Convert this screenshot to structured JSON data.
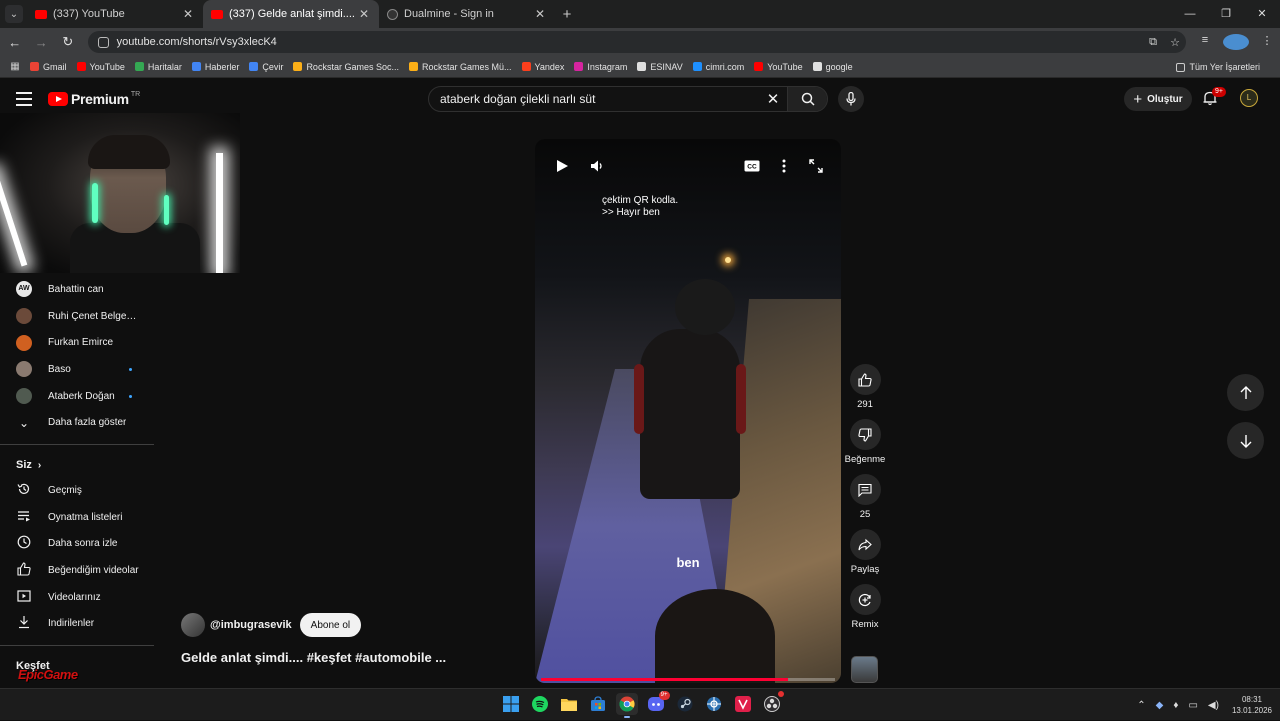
{
  "browser": {
    "tabs": [
      {
        "title": "(337) YouTube",
        "active": false
      },
      {
        "title": "(337) Gelde anlat şimdi.... #keşf",
        "active": true
      },
      {
        "title": "Dualmine - Sign in",
        "active": false
      }
    ],
    "url": "youtube.com/shorts/rVsy3xlecK4",
    "bookmarks": [
      {
        "label": "Gmail",
        "color": "#ea4335"
      },
      {
        "label": "YouTube",
        "color": "#ff0000"
      },
      {
        "label": "Haritalar",
        "color": "#34a853"
      },
      {
        "label": "Haberler",
        "color": "#4285f4"
      },
      {
        "label": "Çevir",
        "color": "#4285f4"
      },
      {
        "label": "Rockstar Games Soc...",
        "color": "#fcaf17"
      },
      {
        "label": "Rockstar Games Mü...",
        "color": "#fcaf17"
      },
      {
        "label": "Yandex",
        "color": "#fc3f1d"
      },
      {
        "label": "Instagram",
        "color": "#d6249f"
      },
      {
        "label": "ESINAV",
        "color": "#e0e0e0"
      },
      {
        "label": "cimri.com",
        "color": "#1e90ff"
      },
      {
        "label": "YouTube",
        "color": "#ff0000"
      },
      {
        "label": "google",
        "color": "#e0e0e0"
      }
    ],
    "all_bookmarks": "Tüm Yer İşaretleri"
  },
  "youtube": {
    "logo_text": "Premium",
    "logo_region": "TR",
    "search_query": "ataberk doğan çilekli narlı süt",
    "create_label": "Oluştur",
    "notifications_badge": "9+"
  },
  "sidebar": {
    "subscriptions": [
      {
        "label": "Bahattin can",
        "avatar": "AW",
        "avatar_color": "#e8e8e8",
        "new": false
      },
      {
        "label": "Ruhi Çenet Belgesel...",
        "avatar": "",
        "avatar_color": "#6b4a3a",
        "new": false
      },
      {
        "label": "Furkan Emirce",
        "avatar": "",
        "avatar_color": "#d06020",
        "new": false
      },
      {
        "label": "Baso",
        "avatar": "",
        "avatar_color": "#8a7a70",
        "new": true
      },
      {
        "label": "Ataberk Doğan",
        "avatar": "",
        "avatar_color": "#505a50",
        "new": true
      }
    ],
    "show_more": "Daha fazla göster",
    "you_heading": "Siz",
    "you_items": [
      {
        "label": "Geçmiş",
        "icon": "history-icon"
      },
      {
        "label": "Oynatma listeleri",
        "icon": "playlist-icon"
      },
      {
        "label": "Daha sonra izle",
        "icon": "clock-icon"
      },
      {
        "label": "Beğendiğim videolar",
        "icon": "thumb-up-icon"
      },
      {
        "label": "Videolarınız",
        "icon": "video-icon"
      },
      {
        "label": "İndirilenler",
        "icon": "download-icon"
      }
    ],
    "explore_heading": "Keşfet"
  },
  "short": {
    "caption_top": [
      "çektim QR kodla.",
      ">> Hayır ben"
    ],
    "caption_bottom": "ben",
    "progress": 0.84,
    "likes": "291",
    "dislike_label": "Beğenme",
    "comments": "25",
    "share_label": "Paylaş",
    "remix_label": "Remix",
    "channel": "@imbugrasevik",
    "subscribe_label": "Abone ol",
    "title": "Gelde anlat şimdi.... #keşfet #automobile ..."
  },
  "watermark": "EpicGame",
  "taskbar": {
    "time": "08:31",
    "date": "13.01.2026",
    "discord_badge": "9+"
  }
}
